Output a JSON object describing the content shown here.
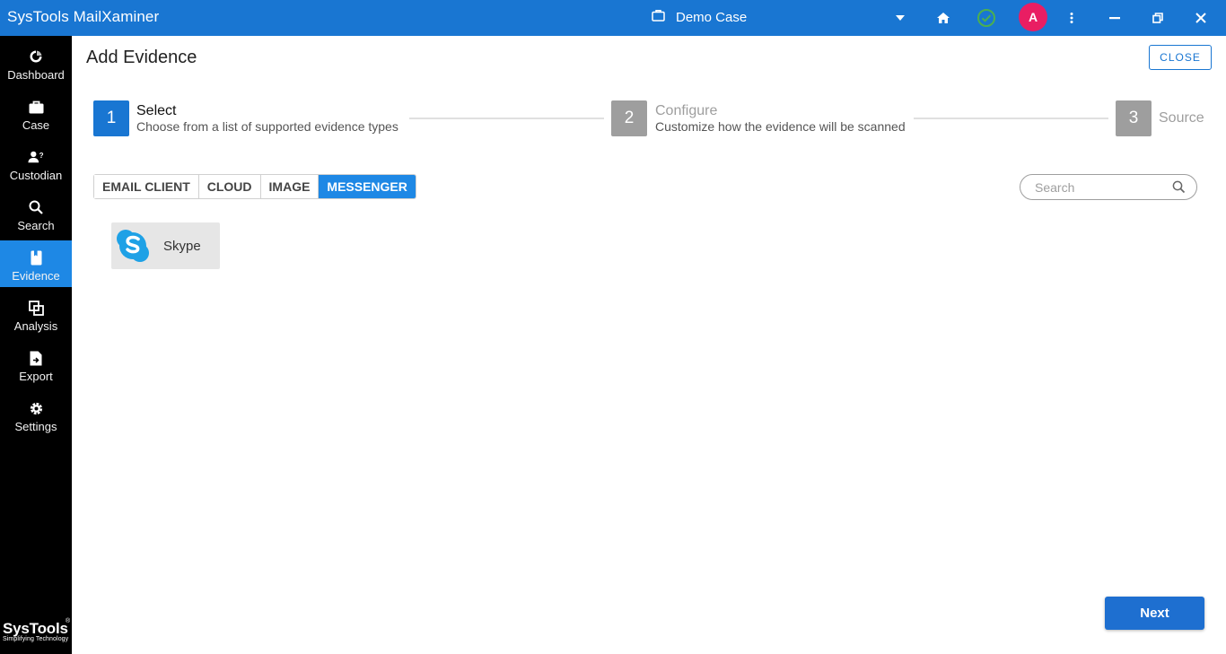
{
  "app": {
    "title": "SysTools MailXaminer",
    "case_name": "Demo Case",
    "avatar_initial": "A"
  },
  "titlebar_icons": [
    "briefcase-icon",
    "dropdown-icon",
    "home-icon",
    "check-circle-icon",
    "more-vert-icon",
    "minimize-icon",
    "restore-icon",
    "close-icon"
  ],
  "sidebar": {
    "items": [
      {
        "label": "Dashboard",
        "icon": "dashboard-icon"
      },
      {
        "label": "Case",
        "icon": "briefcase-icon"
      },
      {
        "label": "Custodian",
        "icon": "custodian-icon"
      },
      {
        "label": "Search",
        "icon": "search-icon"
      },
      {
        "label": "Evidence",
        "icon": "evidence-icon",
        "active": true
      },
      {
        "label": "Analysis",
        "icon": "analysis-icon"
      },
      {
        "label": "Export",
        "icon": "export-icon"
      },
      {
        "label": "Settings",
        "icon": "settings-icon"
      }
    ],
    "brand_name": "SysTools",
    "brand_reg": "®",
    "brand_tagline": "Simplifying Technology"
  },
  "page": {
    "title": "Add Evidence",
    "close_label": "CLOSE",
    "next_label": "Next"
  },
  "stepper": [
    {
      "number": "1",
      "title": "Select",
      "subtitle": "Choose from a list of supported evidence types",
      "active": true
    },
    {
      "number": "2",
      "title": "Configure",
      "subtitle": "Customize how the evidence will be scanned",
      "active": false
    },
    {
      "number": "3",
      "title": "Source",
      "subtitle": "",
      "active": false
    }
  ],
  "tabs": [
    {
      "label": "EMAIL CLIENT",
      "active": false
    },
    {
      "label": "CLOUD",
      "active": false
    },
    {
      "label": "IMAGE",
      "active": false
    },
    {
      "label": "MESSENGER",
      "active": true
    }
  ],
  "search": {
    "placeholder": "Search",
    "value": ""
  },
  "evidence_types": [
    {
      "label": "Skype",
      "icon": "skype-logo-icon"
    }
  ],
  "colors": {
    "titlebar": "#1976d2",
    "sidebar": "#000000",
    "accent": "#1e88e5",
    "avatar": "#e91e63",
    "status_ok": "#4caf50",
    "inactive_step": "#9e9e9e"
  }
}
